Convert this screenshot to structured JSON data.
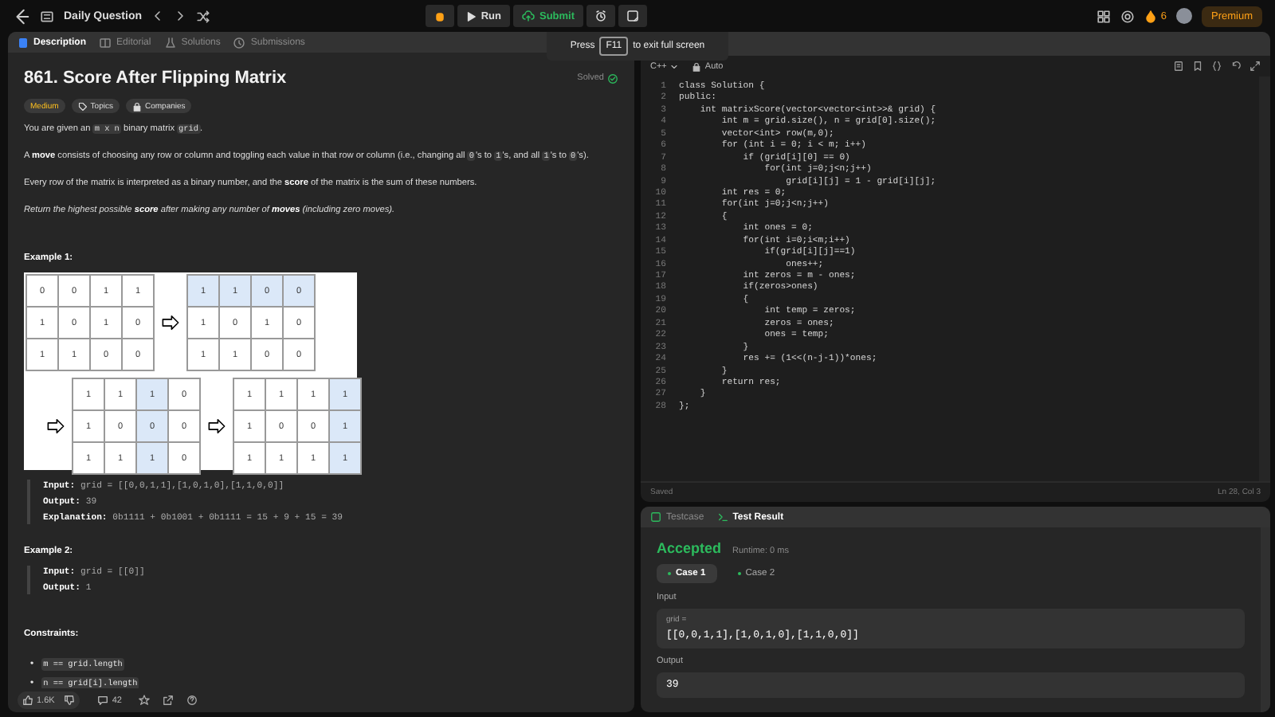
{
  "top_bar": {
    "title": "Daily Question",
    "run": "Run",
    "submit": "Submit",
    "streak": "6",
    "premium": "Premium"
  },
  "fullscreen_hint": {
    "before": "Press",
    "key": "F11",
    "after": "to exit full screen"
  },
  "description": {
    "tabs": [
      {
        "label": "Description",
        "selected": true
      },
      {
        "label": "Editorial",
        "selected": false
      },
      {
        "label": "Solutions",
        "selected": false
      },
      {
        "label": "Submissions",
        "selected": false
      }
    ],
    "title": "861. Score After Flipping Matrix",
    "status": "Solved",
    "tags": [
      {
        "label": "Medium",
        "kind": "difficulty"
      },
      {
        "label": "Topics",
        "kind": "topics"
      },
      {
        "label": "Companies",
        "kind": "companies"
      }
    ],
    "paragraphs": [
      [
        {
          "kind": "text",
          "text": "You are given an "
        },
        {
          "kind": "code",
          "text": "m x n"
        },
        {
          "kind": "text",
          "text": " binary matrix "
        },
        {
          "kind": "code",
          "text": "grid"
        },
        {
          "kind": "text",
          "text": "."
        }
      ],
      [
        {
          "kind": "text",
          "text": "A "
        },
        {
          "kind": "bold",
          "text": "move"
        },
        {
          "kind": "text",
          "text": " consists of choosing any row or column and toggling each value in that row or column (i.e., changing all "
        },
        {
          "kind": "code",
          "text": "0"
        },
        {
          "kind": "text",
          "text": "'s to "
        },
        {
          "kind": "code",
          "text": "1"
        },
        {
          "kind": "text",
          "text": "'s, and all "
        },
        {
          "kind": "code",
          "text": "1"
        },
        {
          "kind": "text",
          "text": "'s to "
        },
        {
          "kind": "code",
          "text": "0"
        },
        {
          "kind": "text",
          "text": "'s)."
        }
      ],
      [
        {
          "kind": "text",
          "text": "Every row of the matrix is interpreted as a binary number, and the "
        },
        {
          "kind": "bold",
          "text": "score"
        },
        {
          "kind": "text",
          "text": " of the matrix is the sum of these numbers."
        }
      ],
      [
        {
          "kind": "italic",
          "text": "Return the highest possible "
        },
        {
          "kind": "bolditalic",
          "text": "score"
        },
        {
          "kind": "italic",
          "text": " after making any number of "
        },
        {
          "kind": "bolditalic",
          "text": "moves"
        },
        {
          "kind": "italic",
          "text": " (including zero moves)."
        }
      ]
    ],
    "examples": [
      {
        "title": "Example 1:",
        "figure": {
          "grids": [
            {
              "rows": [
                [
                  {
                    "v": "0",
                    "highlighted": false
                  },
                  {
                    "v": "0",
                    "highlighted": false
                  },
                  {
                    "v": "1",
                    "highlighted": false
                  },
                  {
                    "v": "1",
                    "highlighted": false
                  }
                ],
                [
                  {
                    "v": "1",
                    "highlighted": false
                  },
                  {
                    "v": "0",
                    "highlighted": false
                  },
                  {
                    "v": "1",
                    "highlighted": false
                  },
                  {
                    "v": "0",
                    "highlighted": false
                  }
                ],
                [
                  {
                    "v": "1",
                    "highlighted": false
                  },
                  {
                    "v": "1",
                    "highlighted": false
                  },
                  {
                    "v": "0",
                    "highlighted": false
                  },
                  {
                    "v": "0",
                    "highlighted": false
                  }
                ]
              ]
            },
            {
              "rows": [
                [
                  {
                    "v": "1",
                    "highlighted": true
                  },
                  {
                    "v": "1",
                    "highlighted": true
                  },
                  {
                    "v": "0",
                    "highlighted": true
                  },
                  {
                    "v": "0",
                    "highlighted": true
                  }
                ],
                [
                  {
                    "v": "1",
                    "highlighted": false
                  },
                  {
                    "v": "0",
                    "highlighted": false
                  },
                  {
                    "v": "1",
                    "highlighted": false
                  },
                  {
                    "v": "0",
                    "highlighted": false
                  }
                ],
                [
                  {
                    "v": "1",
                    "highlighted": false
                  },
                  {
                    "v": "1",
                    "highlighted": false
                  },
                  {
                    "v": "0",
                    "highlighted": false
                  },
                  {
                    "v": "0",
                    "highlighted": false
                  }
                ]
              ]
            },
            {
              "rows": [
                [
                  {
                    "v": "1",
                    "highlighted": false
                  },
                  {
                    "v": "1",
                    "highlighted": false
                  },
                  {
                    "v": "1",
                    "highlighted": true
                  },
                  {
                    "v": "0",
                    "highlighted": false
                  }
                ],
                [
                  {
                    "v": "1",
                    "highlighted": false
                  },
                  {
                    "v": "0",
                    "highlighted": false
                  },
                  {
                    "v": "0",
                    "highlighted": true
                  },
                  {
                    "v": "0",
                    "highlighted": false
                  }
                ],
                [
                  {
                    "v": "1",
                    "highlighted": false
                  },
                  {
                    "v": "1",
                    "highlighted": false
                  },
                  {
                    "v": "1",
                    "highlighted": true
                  },
                  {
                    "v": "0",
                    "highlighted": false
                  }
                ]
              ]
            },
            {
              "rows": [
                [
                  {
                    "v": "1",
                    "highlighted": false
                  },
                  {
                    "v": "1",
                    "highlighted": false
                  },
                  {
                    "v": "1",
                    "highlighted": false
                  },
                  {
                    "v": "1",
                    "highlighted": true
                  }
                ],
                [
                  {
                    "v": "1",
                    "highlighted": false
                  },
                  {
                    "v": "0",
                    "highlighted": false
                  },
                  {
                    "v": "0",
                    "highlighted": false
                  },
                  {
                    "v": "1",
                    "highlighted": true
                  }
                ],
                [
                  {
                    "v": "1",
                    "highlighted": false
                  },
                  {
                    "v": "1",
                    "highlighted": false
                  },
                  {
                    "v": "1",
                    "highlighted": false
                  },
                  {
                    "v": "1",
                    "highlighted": true
                  }
                ]
              ]
            }
          ]
        },
        "lines": [
          {
            "label": "Input:",
            "value": "grid = [[0,0,1,1],[1,0,1,0],[1,1,0,0]]"
          },
          {
            "label": "Output:",
            "value": "39"
          },
          {
            "label": "Explanation:",
            "value": "0b1111 + 0b1001 + 0b1111 = 15 + 9 + 15 = 39"
          }
        ]
      },
      {
        "title": "Example 2:",
        "lines": [
          {
            "label": "Input:",
            "value": "grid = [[0]]"
          },
          {
            "label": "Output:",
            "value": "1"
          }
        ]
      }
    ],
    "constraints_title": "Constraints:",
    "constraints": [
      {
        "bullet": "•",
        "text": "m == grid.length"
      },
      {
        "bullet": "•",
        "text": "n == grid[i].length"
      }
    ],
    "footer": {
      "likes": "1.6K",
      "comments": "42"
    }
  },
  "editor": {
    "language": "C++",
    "mode": "Auto",
    "lines": [
      {
        "number": "1",
        "text": "class Solution {"
      },
      {
        "number": "2",
        "text": "public:"
      },
      {
        "number": "3",
        "text": "    int matrixScore(vector<vector<int>>& grid) {"
      },
      {
        "number": "4",
        "text": "        int m = grid.size(), n = grid[0].size();"
      },
      {
        "number": "5",
        "text": "        vector<int> row(m,0);"
      },
      {
        "number": "6",
        "text": "        for (int i = 0; i < m; i++)"
      },
      {
        "number": "7",
        "text": "            if (grid[i][0] == 0)"
      },
      {
        "number": "8",
        "text": "                for(int j=0;j<n;j++)"
      },
      {
        "number": "9",
        "text": "                    grid[i][j] = 1 - grid[i][j];"
      },
      {
        "number": "10",
        "text": "        int res = 0;"
      },
      {
        "number": "11",
        "text": "        for(int j=0;j<n;j++)"
      },
      {
        "number": "12",
        "text": "        {"
      },
      {
        "number": "13",
        "text": "            int ones = 0;"
      },
      {
        "number": "14",
        "text": "            for(int i=0;i<m;i++)"
      },
      {
        "number": "15",
        "text": "                if(grid[i][j]==1)"
      },
      {
        "number": "16",
        "text": "                    ones++;"
      },
      {
        "number": "17",
        "text": "            int zeros = m - ones;"
      },
      {
        "number": "18",
        "text": "            if(zeros>ones)"
      },
      {
        "number": "19",
        "text": "            {"
      },
      {
        "number": "20",
        "text": "                int temp = zeros;"
      },
      {
        "number": "21",
        "text": "                zeros = ones;"
      },
      {
        "number": "22",
        "text": "                ones = temp;"
      },
      {
        "number": "23",
        "text": "            }"
      },
      {
        "number": "24",
        "text": "            res += (1<<(n-j-1))*ones;"
      },
      {
        "number": "25",
        "text": "        }"
      },
      {
        "number": "26",
        "text": "        return res;"
      },
      {
        "number": "27",
        "text": "    }"
      },
      {
        "number": "28",
        "text": "};"
      }
    ],
    "status": "Saved",
    "cursor": "Ln 28, Col 3"
  },
  "result": {
    "tabs": [
      {
        "label": "Testcase",
        "selected": false
      },
      {
        "label": "Test Result",
        "selected": true
      }
    ],
    "verdict": "Accepted",
    "runtime": "Runtime: 0 ms",
    "cases": [
      {
        "label": "Case 1",
        "selected": true
      },
      {
        "label": "Case 2",
        "selected": false
      }
    ],
    "sections": [
      {
        "label": "Input",
        "name": "grid =",
        "value": "[[0,0,1,1],[1,0,1,0],[1,1,0,0]]"
      },
      {
        "label": "Output",
        "value": "39"
      }
    ]
  }
}
